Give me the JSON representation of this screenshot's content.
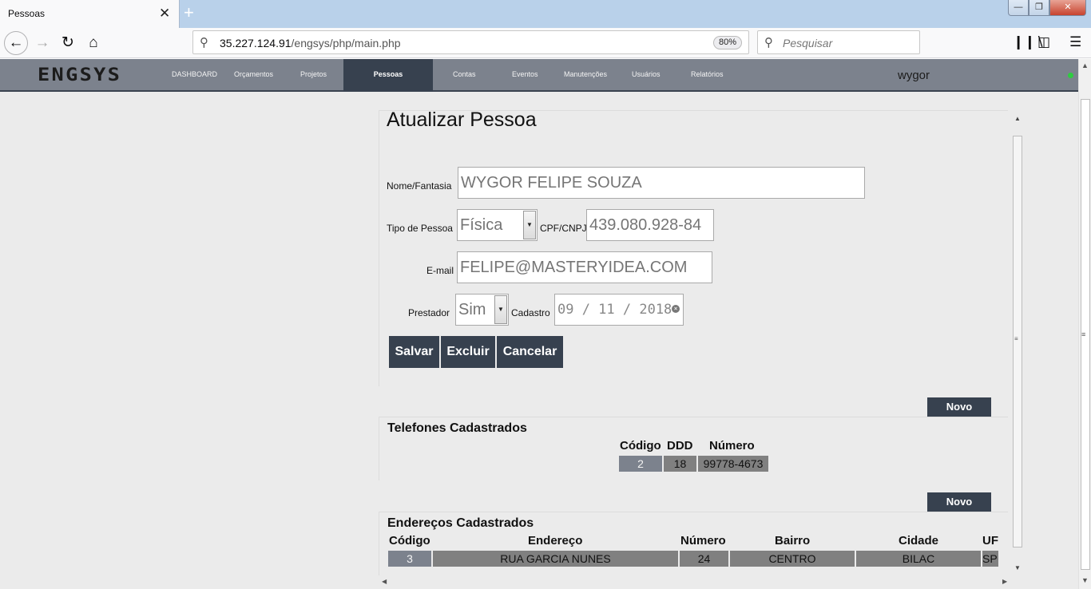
{
  "browser": {
    "tab_title": "Pessoas",
    "tab_close": "✕",
    "new_tab": "+",
    "url_host": "35.227.124.91",
    "url_path": "/engsys/php/main.php",
    "zoom": "80%",
    "search_placeholder": "Pesquisar",
    "icons": {
      "back": "back-arrow-icon",
      "forward": "forward-arrow-icon",
      "reload": "reload-icon",
      "home": "home-icon",
      "url_search": "magnifier-icon",
      "search": "magnifier-icon",
      "library": "library-icon",
      "sidebar": "sidebar-icon",
      "menu": "hamburger-menu-icon"
    }
  },
  "app": {
    "logo": "ENGSYS",
    "menu": {
      "dashboard": "DASHBOARD",
      "orcamentos": "Orçamentos",
      "projetos": "Projetos",
      "pessoas": "Pessoas",
      "contas": "Contas",
      "eventos": "Eventos",
      "manutencoes": "Manutenções",
      "usuarios": "Usuários",
      "relatorios": "Relatórios"
    },
    "active_menu": "Pessoas",
    "user": "wygor",
    "status_color": "#2ecc40"
  },
  "form": {
    "title": "Atualizar Pessoa",
    "nome_label": "Nome/Fantasia",
    "nome_value": "WYGOR FELIPE SOUZA",
    "tipo_label": "Tipo de Pessoa",
    "tipo_value": "Física",
    "cpf_label": "CPF/CNPJ",
    "cpf_value": "439.080.928-84",
    "email_label": "E-mail",
    "email_value": "FELIPE@MASTERYIDEA.COM",
    "prestador_label": "Prestador",
    "prestador_value": "Sim",
    "cadastro_label": "Cadastro",
    "cadastro_value": "09 / 11 / 2018",
    "salvar": "Salvar",
    "excluir": "Excluir",
    "cancelar": "Cancelar"
  },
  "telefones": {
    "novo": "Novo",
    "title": "Telefones Cadastrados",
    "headers": [
      "Código",
      "DDD",
      "Número"
    ],
    "rows": [
      [
        "2",
        "18",
        "99778-4673"
      ]
    ]
  },
  "enderecos": {
    "novo": "Novo",
    "title": "Endereços Cadastrados",
    "headers": [
      "Código",
      "Endereço",
      "Número",
      "Bairro",
      "Cidade",
      "UF"
    ],
    "rows": [
      [
        "3",
        "RUA GARCIA NUNES",
        "24",
        "CENTRO",
        "BILAC",
        "SP"
      ]
    ]
  },
  "colors": {
    "nav_bg": "#7c828d",
    "nav_active": "#37414f",
    "button": "#37414f",
    "page_bg": "#ebebeb",
    "cell": "#808080"
  }
}
